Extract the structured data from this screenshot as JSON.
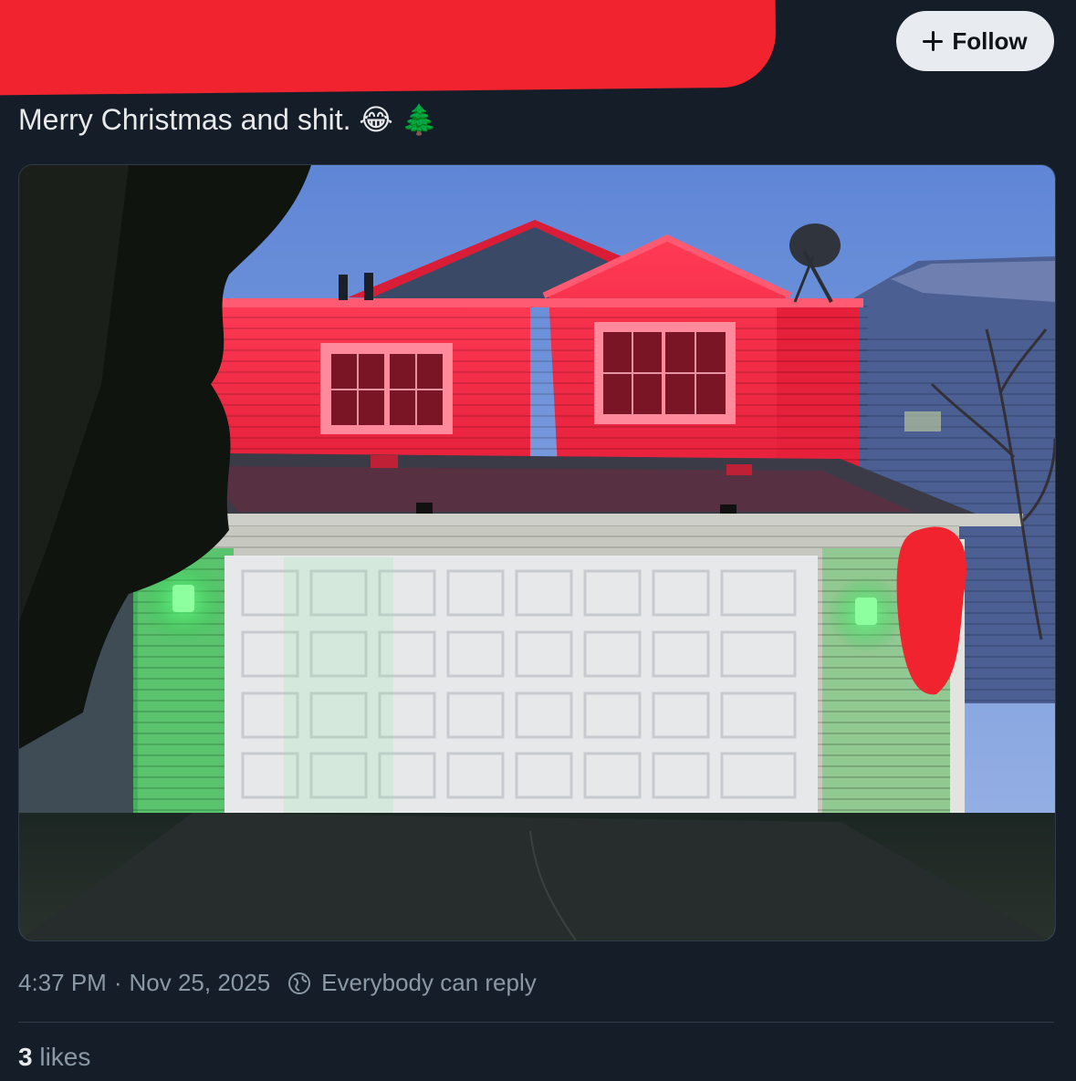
{
  "header": {
    "follow_label": "Follow"
  },
  "post": {
    "text": "Merry Christmas and shit.",
    "emojis": [
      "😂",
      "🌲"
    ],
    "time": "4:37 PM",
    "separator": "·",
    "date": "Nov 25, 2025",
    "reply_setting": "Everybody can reply"
  },
  "engagement": {
    "likes_count": "3",
    "likes_label": "likes"
  },
  "colors": {
    "background": "#151d28",
    "redaction": "#f0232e",
    "muted_text": "#8b98a5",
    "red_light": "#ff2a45",
    "green_light": "#3cff6a"
  }
}
